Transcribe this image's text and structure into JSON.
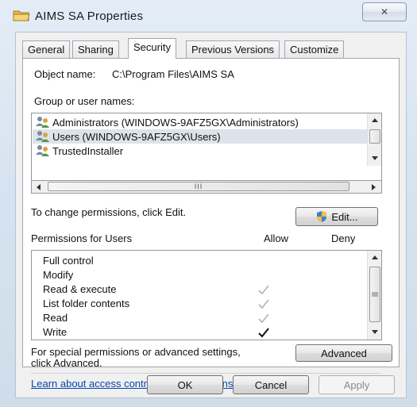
{
  "window": {
    "title": "AIMS SA Properties",
    "close_glyph": "✕",
    "title_icon": "folder-icon",
    "accent": "#0645ad"
  },
  "tabs": [
    {
      "label": "General",
      "active": false
    },
    {
      "label": "Sharing",
      "active": false
    },
    {
      "label": "Security",
      "active": true
    },
    {
      "label": "Previous Versions",
      "active": false
    },
    {
      "label": "Customize",
      "active": false
    }
  ],
  "security": {
    "object_name_label": "Object name:",
    "object_name_value": "C:\\Program Files\\AIMS SA",
    "group_label": "Group or user names:",
    "users": [
      {
        "name": "Administrators (WINDOWS-9AFZ5GX\\Administrators)",
        "selected": false,
        "icon": "user-group-icon"
      },
      {
        "name": "Users (WINDOWS-9AFZ5GX\\Users)",
        "selected": true,
        "icon": "user-group-icon"
      },
      {
        "name": "TrustedInstaller",
        "selected": false,
        "icon": "user-group-icon"
      }
    ],
    "hscroll_grip": "III",
    "change_text": "To change permissions, click Edit.",
    "edit_button": "Edit...",
    "permissions_label": "Permissions for Users",
    "allow_header": "Allow",
    "deny_header": "Deny",
    "permissions": [
      {
        "name": "Full control",
        "allow": "none"
      },
      {
        "name": "Modify",
        "allow": "none"
      },
      {
        "name": "Read & execute",
        "allow": "inherited"
      },
      {
        "name": "List folder contents",
        "allow": "inherited"
      },
      {
        "name": "Read",
        "allow": "inherited"
      },
      {
        "name": "Write",
        "allow": "explicit"
      }
    ],
    "special_line1": "For special permissions or advanced settings,",
    "special_line2": "click Advanced.",
    "advanced_button": "Advanced",
    "learn_link": "Learn about access control and permissions"
  },
  "footer": {
    "ok": "OK",
    "cancel": "Cancel",
    "apply": "Apply"
  }
}
